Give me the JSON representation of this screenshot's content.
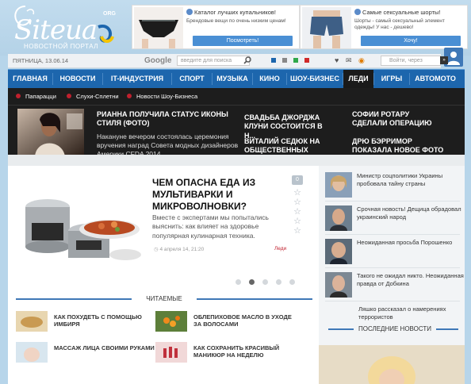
{
  "logo": {
    "word": "Siteua",
    "org": "ORG",
    "subtitle": "НОВОСТНОЙ ПОРТАЛ"
  },
  "ads": [
    {
      "title": "Каталог лучших купальников!",
      "desc": "Брендовые вещи по очень низким ценам!",
      "button": "Посмотреть!"
    },
    {
      "title": "Самые сексуальные шорты!",
      "desc": "Шорты - самый сексуальный элемент одежды! У нас - дешево!",
      "button": "Хочу!"
    }
  ],
  "utilbar": {
    "date": "ПЯТНИЦА, 13.06.14",
    "google": "Google",
    "search_placeholder": "введите для поиска",
    "login_placeholder": "Войти, через"
  },
  "nav": [
    {
      "label": "ГЛАВНАЯ",
      "active": false
    },
    {
      "label": "НОВОСТИ",
      "active": false
    },
    {
      "label": "IT-ИНДУСТРИЯ",
      "active": false
    },
    {
      "label": "СПОРТ",
      "active": false
    },
    {
      "label": "МУЗЫКА",
      "active": false
    },
    {
      "label": "КИНО",
      "active": false
    },
    {
      "label": "ШОУ-БИЗНЕС",
      "active": false
    },
    {
      "label": "ЛЕДИ",
      "active": true
    },
    {
      "label": "ИГРЫ",
      "active": false
    },
    {
      "label": "АВТОМОТО",
      "active": false
    }
  ],
  "subnav": [
    "Папарацци",
    "Слухи-Сплетни",
    "Новости Шоу-Бизнеса"
  ],
  "featured": {
    "main_title": "РИАННА ПОЛУЧИЛА СТАТУС ИКОНЫ СТИЛЯ (ФОТО)",
    "main_desc": "Накануне вечером состоялась церемония вручения наград Совета модных дизайнеров Америки CFDA 2014.",
    "items": [
      "СВАДЬБА ДЖОРДЖА КЛУНИ СОСТОИТСЯ В Н...",
      "ВИТАЛИЙ СЕДЮК НА ОБЩЕСТВЕННЫХ РАБОТ...",
      "СОФИИ РОТАРУ СДЕЛАЛИ ОПЕРАЦИЮ",
      "ДРЮ БЭРРИМОР ПОКАЗАЛА НОВОЕ ФОТО ДЕ..."
    ]
  },
  "main": {
    "title": "ЧЕМ ОПАСНА ЕДА ИЗ МУЛЬТИВАРКИ И МИКРОВОЛНОВКИ?",
    "desc": "Вместе с экспертами мы попытались выяснить: как влияет на здоровье популярная кулинарная техника.",
    "date": "4 апреля 14, 21:20",
    "category": "Леди",
    "comments": "0",
    "rating_stars": 5,
    "slider_active": 2,
    "slider_count": 5
  },
  "read": {
    "heading": "ЧИТАЕМЫЕ",
    "items": [
      "КАК ПОХУДЕТЬ С ПОМОЩЬЮ ИМБИРЯ",
      "ОБЛЕПИХОВОЕ МАСЛО В УХОДЕ ЗА ВОЛОСАМИ",
      "МАССАЖ ЛИЦА СВОИМИ РУКАМИ",
      "КАК СОХРАНИТЬ КРАСИВЫЙ МАНИКЮР НА НЕДЕЛЮ"
    ]
  },
  "side": {
    "items": [
      "Министр соцполитики Украины пробовала тайну страны",
      "Срочная новость! Дещица обрадовал украинский народ",
      "Неожиданная просьба Порошенко",
      "Такого не ожидал никто. Неожиданная правда от Добкина",
      "Ляшко рассказал о намерениях террористов"
    ],
    "last_heading": "ПОСЛЕДНИЕ НОВОСТИ"
  },
  "colors": {
    "nav_blue": "#1d66ad",
    "accent_red": "#c0202e",
    "dark_bar": "#1d1d1d"
  }
}
